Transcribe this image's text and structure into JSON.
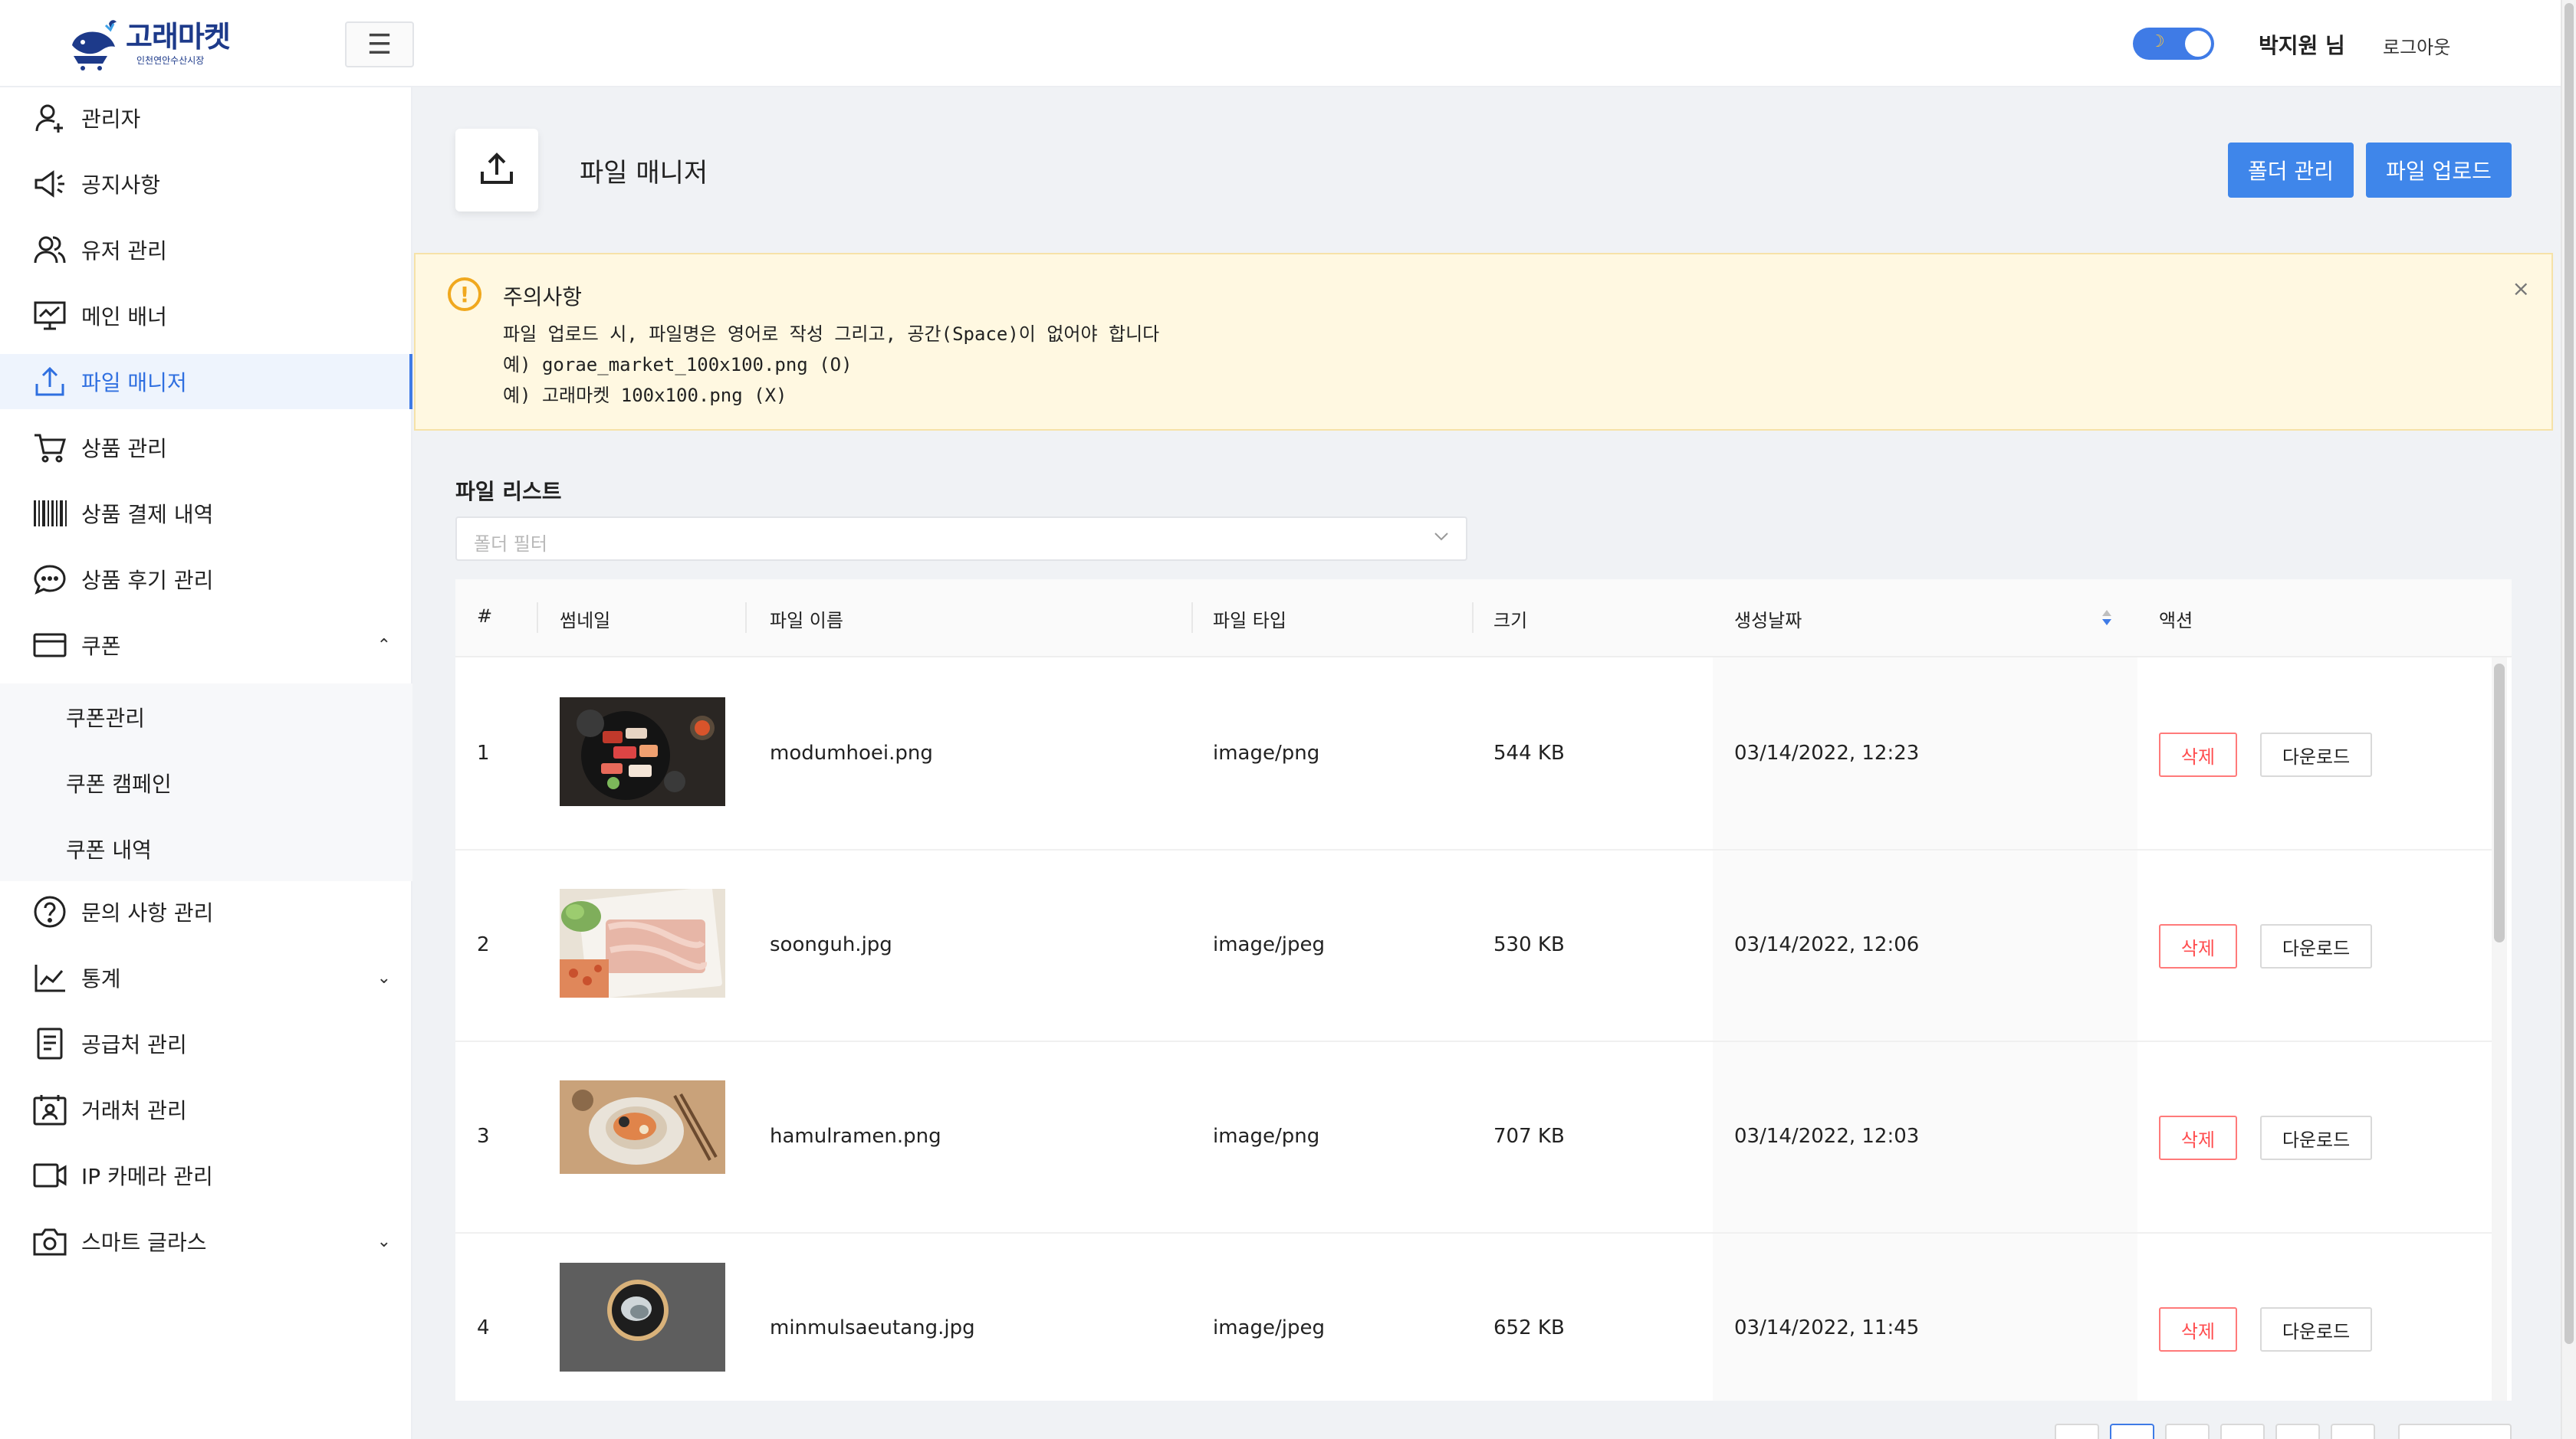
{
  "header": {
    "logo_title": "고래마켓",
    "logo_subtitle": "인천연안수산시장",
    "menu_icon": "hamburger-icon",
    "theme_toggle": {
      "state": "dark",
      "icon": "moon-icon"
    },
    "user_name": "박지원 님",
    "logout_label": "로그아웃"
  },
  "sidebar": {
    "items": [
      {
        "label": "관리자",
        "icon": "user-admin-icon"
      },
      {
        "label": "공지사항",
        "icon": "megaphone-icon"
      },
      {
        "label": "유저 관리",
        "icon": "users-icon"
      },
      {
        "label": "메인 배너",
        "icon": "presentation-chart-icon"
      },
      {
        "label": "파일 매니저",
        "icon": "upload-icon",
        "active": true
      },
      {
        "label": "상품 관리",
        "icon": "cart-icon"
      },
      {
        "label": "상품 결제 내역",
        "icon": "barcode-icon"
      },
      {
        "label": "상품 후기 관리",
        "icon": "chat-bubble-icon"
      },
      {
        "label": "쿠폰",
        "icon": "card-icon",
        "expanded": true
      },
      {
        "label": "문의 사항 관리",
        "icon": "question-circle-icon"
      },
      {
        "label": "통계",
        "icon": "line-chart-icon"
      },
      {
        "label": "공급처 관리",
        "icon": "document-icon"
      },
      {
        "label": "거래처 관리",
        "icon": "contact-calendar-icon"
      },
      {
        "label": "IP 카메라 관리",
        "icon": "video-camera-icon"
      },
      {
        "label": "스마트 글라스",
        "icon": "camera-icon"
      }
    ],
    "coupon_sub": [
      "쿠폰관리",
      "쿠폰 캠페인",
      "쿠폰 내역"
    ]
  },
  "page": {
    "title": "파일 매니저",
    "folder_manage_label": "폴더 관리",
    "file_upload_label": "파일 업로드"
  },
  "notice": {
    "title": "주의사항",
    "lines": [
      "파일 업로드 시, 파일명은 영어로 작성 그리고, 공간(Space)이 없어야 합니다",
      "예) gorae_market_100x100.png (O)",
      "예) 고래마켓 100x100.png (X)"
    ],
    "close_label": "×"
  },
  "file_list": {
    "title": "파일 리스트",
    "folder_filter_placeholder": "폴더 필터",
    "columns": [
      "#",
      "썸네일",
      "파일 이름",
      "파일 타입",
      "크기",
      "생성날짜",
      "액션"
    ],
    "delete_label": "삭제",
    "download_label": "다운로드",
    "rows": [
      {
        "no": "1",
        "name": "modumhoei.png",
        "type": "image/png",
        "size": "544 KB",
        "created": "03/14/2022, 12:23"
      },
      {
        "no": "2",
        "name": "soonguh.jpg",
        "type": "image/jpeg",
        "size": "530 KB",
        "created": "03/14/2022, 12:06"
      },
      {
        "no": "3",
        "name": "hamulramen.png",
        "type": "image/png",
        "size": "707 KB",
        "created": "03/14/2022, 12:03"
      },
      {
        "no": "4",
        "name": "minmulsaeutang.jpg",
        "type": "image/jpeg",
        "size": "652 KB",
        "created": "03/14/2022, 11:45"
      }
    ]
  },
  "colors": {
    "primary": "#3f86ea",
    "active_nav_text": "#2f6fe0",
    "danger": "#ff4d4f",
    "notice_bg": "#fff8e1",
    "warning": "#f0a81e"
  }
}
